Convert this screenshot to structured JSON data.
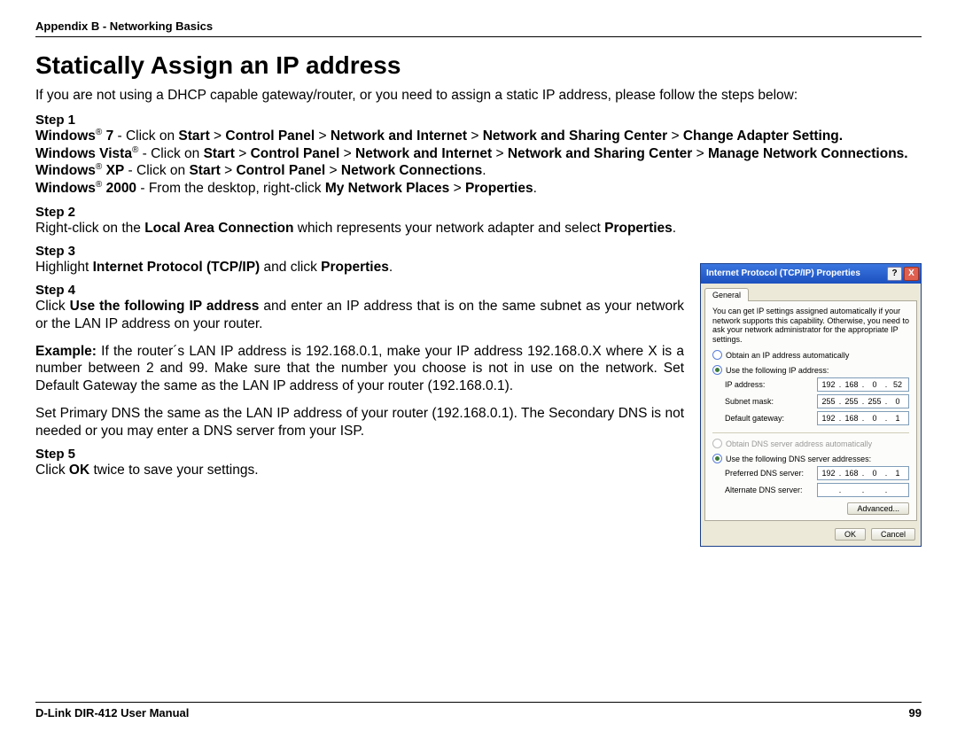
{
  "header": "Appendix B - Networking Basics",
  "title": "Statically Assign an IP address",
  "intro": "If you are not using a DHCP capable gateway/router, or you need to assign a static IP address, please follow the steps below:",
  "steps": {
    "s1": "Step 1",
    "s2": "Step 2",
    "s3": "Step 3",
    "s4": "Step 4",
    "s5": "Step 5"
  },
  "s1_lines": {
    "w7_a": "Windows",
    "w7_b": " 7",
    "w7_c": " - Click on ",
    "w7_d": "Start",
    "w7_e": " > ",
    "w7_f": "Control Panel",
    "w7_g": " > ",
    "w7_h": "Network and Internet",
    "w7_i": " > ",
    "w7_j": "Network and Sharing Center",
    "w7_k": " > ",
    "w7_l": "Change Adapter Setting.",
    "vista_a": "Windows Vista",
    "vista_b": " - Click on ",
    "vista_c": "Start",
    "vista_d": " > ",
    "vista_e": "Control Panel",
    "vista_f": " > ",
    "vista_g": "Network and Internet",
    "vista_h": " > ",
    "vista_i": "Network and Sharing Center",
    "vista_j": " > ",
    "vista_k": "Manage Network Connections.",
    "xp_a": "Windows",
    "xp_b": " XP",
    "xp_c": " - Click on ",
    "xp_d": "Start",
    "xp_e": " > ",
    "xp_f": "Control Panel",
    "xp_g": " > ",
    "xp_h": "Network Connections",
    "xp_i": ".",
    "w2k_a": "Windows",
    "w2k_b": " 2000",
    "w2k_c": " - From the desktop, right-click ",
    "w2k_d": "My Network Places",
    "w2k_e": " > ",
    "w2k_f": "Properties",
    "w2k_g": "."
  },
  "s2_text": {
    "a": "Right-click on the ",
    "b": "Local Area Connection",
    "c": " which represents your network adapter and select ",
    "d": "Properties",
    "e": "."
  },
  "s3_text": {
    "a": "Highlight ",
    "b": "Internet Protocol (TCP/IP)",
    "c": " and click ",
    "d": "Properties",
    "e": "."
  },
  "s4_text": {
    "p1a": "Click ",
    "p1b": "Use the following IP address",
    "p1c": " and enter an IP address that is on the same subnet as your network or the LAN IP address on your router.",
    "p2a": "Example:",
    "p2b": " If the router´s LAN IP address is 192.168.0.1, make your IP address 192.168.0.X where X is a number between 2 and 99. Make sure that the number you choose is not in use on the network. Set Default Gateway the same as the LAN IP address of your router (192.168.0.1).",
    "p3": "Set Primary DNS the same as the LAN IP address of your router (192.168.0.1). The Secondary DNS is not needed or you may enter a DNS server from your ISP."
  },
  "s5_text": {
    "a": "Click ",
    "b": "OK",
    "c": " twice to save your settings."
  },
  "footer": {
    "left": "D-Link DIR-412 User Manual",
    "right": "99"
  },
  "dialog": {
    "title": "Internet Protocol (TCP/IP) Properties",
    "help": "?",
    "close": "X",
    "tab": "General",
    "note": "You can get IP settings assigned automatically if your network supports this capability. Otherwise, you need to ask your network administrator for the appropriate IP settings.",
    "radio_auto_ip": "Obtain an IP address automatically",
    "radio_use_ip": "Use the following IP address:",
    "lbl_ip": "IP address:",
    "lbl_mask": "Subnet mask:",
    "lbl_gw": "Default gateway:",
    "radio_auto_dns": "Obtain DNS server address automatically",
    "radio_use_dns": "Use the following DNS server addresses:",
    "lbl_pdns": "Preferred DNS server:",
    "lbl_adns": "Alternate DNS server:",
    "ip": [
      "192",
      "168",
      "0",
      "52"
    ],
    "mask": [
      "255",
      "255",
      "255",
      "0"
    ],
    "gw": [
      "192",
      "168",
      "0",
      "1"
    ],
    "pdns": [
      "192",
      "168",
      "0",
      "1"
    ],
    "adns": [
      "",
      "",
      "",
      ""
    ],
    "btn_adv": "Advanced...",
    "btn_ok": "OK",
    "btn_cancel": "Cancel",
    "dot": "."
  },
  "reg": "®"
}
